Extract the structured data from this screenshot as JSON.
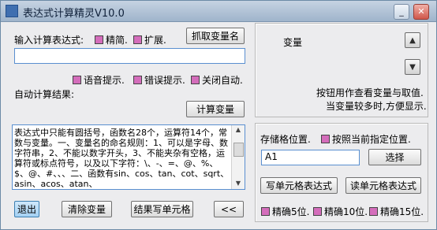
{
  "window": {
    "title": "表达式计算精灵V10.0",
    "minimize_icon": "minimize-icon",
    "close_icon": "close-icon"
  },
  "expression": {
    "label": "输入计算表达式:",
    "check_simple": "精简.",
    "check_extend": "扩展.",
    "fetch_var_button": "抓取变量名",
    "input_value": ""
  },
  "options": {
    "voice_hint": "语音提示.",
    "error_hint": "错误提示.",
    "auto_close": "关闭自动."
  },
  "result": {
    "label": "自动计算结果:",
    "calc_var_button": "计算变量"
  },
  "variables": {
    "header": "变量",
    "up_icon": "triangle-up-icon",
    "down_icon": "triangle-down-icon",
    "hint_line1": "按钮用作查看变量与取值.",
    "hint_line2": "当变量较多时,方便显示."
  },
  "help_text": "表达式中只能有圆括号，函数名28个，运算符14个，常数与变量。一、变量名的命名规则：1、可以是字母、数字符串，2、不能以数字开头，3、不能夹杂有空格，运算符或标点符号，以及以下字符：\\、-、=、@、%、$、@、#、、、二、函数有sin、cos、tan、cot、sqrt、asin、acos、atan、",
  "storage": {
    "label": "存储格位置.",
    "check_by_current": "按照当前指定位置.",
    "cell_value": "A1",
    "select_button": "选择",
    "write_cell_expr_button": "写单元格表达式",
    "read_cell_expr_button": "读单元格表达式",
    "precision_5": "精确5位.",
    "precision_10": "精确10位.",
    "precision_15": "精确15位."
  },
  "bottom": {
    "exit_button": "退出",
    "clear_var_button": "清除变量",
    "write_result_button": "结果写单元格",
    "collapse_button": "<<"
  },
  "colors": {
    "checkbox": "#d46dbb",
    "input_border": "#5a8fd0",
    "titlebar": "#b3c4d7"
  }
}
